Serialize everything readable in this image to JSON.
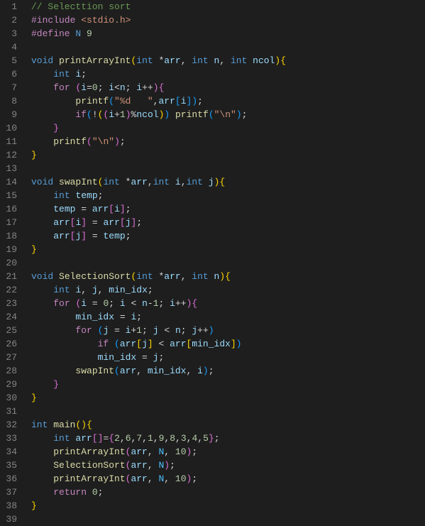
{
  "gutter": {
    "start": 1,
    "end": 39
  },
  "code": {
    "lines": [
      [
        [
          "tok-comment",
          "// Selecttion sort"
        ]
      ],
      [
        [
          "tok-keyword",
          "#include"
        ],
        [
          "tok-op",
          " "
        ],
        [
          "tok-string",
          "<stdio.h>"
        ]
      ],
      [
        [
          "tok-keyword",
          "#define"
        ],
        [
          "tok-op",
          " "
        ],
        [
          "tok-macrofn",
          "N"
        ],
        [
          "tok-op",
          " "
        ],
        [
          "tok-num",
          "9"
        ]
      ],
      [],
      [
        [
          "tok-type",
          "void"
        ],
        [
          "tok-op",
          " "
        ],
        [
          "tok-func",
          "printArrayInt"
        ],
        [
          "tok-brace",
          "("
        ],
        [
          "tok-type",
          "int"
        ],
        [
          "tok-op",
          " *"
        ],
        [
          "tok-var",
          "arr"
        ],
        [
          "tok-op",
          ", "
        ],
        [
          "tok-type",
          "int"
        ],
        [
          "tok-op",
          " "
        ],
        [
          "tok-var",
          "n"
        ],
        [
          "tok-op",
          ", "
        ],
        [
          "tok-type",
          "int"
        ],
        [
          "tok-op",
          " "
        ],
        [
          "tok-var",
          "ncol"
        ],
        [
          "tok-brace",
          ")"
        ],
        [
          "tok-brace",
          "{"
        ]
      ],
      [
        [
          "tok-op",
          "    "
        ],
        [
          "tok-type",
          "int"
        ],
        [
          "tok-op",
          " "
        ],
        [
          "tok-var",
          "i"
        ],
        [
          "tok-op",
          ";"
        ]
      ],
      [
        [
          "tok-op",
          "    "
        ],
        [
          "tok-keyword",
          "for"
        ],
        [
          "tok-op",
          " "
        ],
        [
          "tok-brace2",
          "("
        ],
        [
          "tok-var",
          "i"
        ],
        [
          "tok-op",
          "="
        ],
        [
          "tok-num",
          "0"
        ],
        [
          "tok-op",
          "; "
        ],
        [
          "tok-var",
          "i"
        ],
        [
          "tok-op",
          "<"
        ],
        [
          "tok-var",
          "n"
        ],
        [
          "tok-op",
          "; "
        ],
        [
          "tok-var",
          "i"
        ],
        [
          "tok-op",
          "++"
        ],
        [
          "tok-brace2",
          ")"
        ],
        [
          "tok-brace2",
          "{"
        ]
      ],
      [
        [
          "tok-op",
          "        "
        ],
        [
          "tok-func",
          "printf"
        ],
        [
          "tok-brace3",
          "("
        ],
        [
          "tok-string",
          "\"%d   \""
        ],
        [
          "tok-op",
          ","
        ],
        [
          "tok-var",
          "arr"
        ],
        [
          "tok-brace3",
          "["
        ],
        [
          "tok-var",
          "i"
        ],
        [
          "tok-brace3",
          "]"
        ],
        [
          "tok-brace3",
          ")"
        ],
        [
          "tok-op",
          ";"
        ]
      ],
      [
        [
          "tok-op",
          "        "
        ],
        [
          "tok-keyword",
          "if"
        ],
        [
          "tok-brace3",
          "("
        ],
        [
          "tok-op",
          "!"
        ],
        [
          "tok-brace",
          "("
        ],
        [
          "tok-brace2",
          "("
        ],
        [
          "tok-var",
          "i"
        ],
        [
          "tok-op",
          "+"
        ],
        [
          "tok-num",
          "1"
        ],
        [
          "tok-brace2",
          ")"
        ],
        [
          "tok-op",
          "%"
        ],
        [
          "tok-var",
          "ncol"
        ],
        [
          "tok-brace",
          ")"
        ],
        [
          "tok-brace3",
          ")"
        ],
        [
          "tok-op",
          " "
        ],
        [
          "tok-func",
          "printf"
        ],
        [
          "tok-brace3",
          "("
        ],
        [
          "tok-string",
          "\"\\n\""
        ],
        [
          "tok-brace3",
          ")"
        ],
        [
          "tok-op",
          ";"
        ]
      ],
      [
        [
          "tok-op",
          "    "
        ],
        [
          "tok-brace2",
          "}"
        ]
      ],
      [
        [
          "tok-op",
          "    "
        ],
        [
          "tok-func",
          "printf"
        ],
        [
          "tok-brace2",
          "("
        ],
        [
          "tok-string",
          "\"\\n\""
        ],
        [
          "tok-brace2",
          ")"
        ],
        [
          "tok-op",
          ";"
        ]
      ],
      [
        [
          "tok-brace",
          "}"
        ]
      ],
      [],
      [
        [
          "tok-type",
          "void"
        ],
        [
          "tok-op",
          " "
        ],
        [
          "tok-func",
          "swapInt"
        ],
        [
          "tok-brace",
          "("
        ],
        [
          "tok-type",
          "int"
        ],
        [
          "tok-op",
          " *"
        ],
        [
          "tok-var",
          "arr"
        ],
        [
          "tok-op",
          ","
        ],
        [
          "tok-type",
          "int"
        ],
        [
          "tok-op",
          " "
        ],
        [
          "tok-var",
          "i"
        ],
        [
          "tok-op",
          ","
        ],
        [
          "tok-type",
          "int"
        ],
        [
          "tok-op",
          " "
        ],
        [
          "tok-var",
          "j"
        ],
        [
          "tok-brace",
          ")"
        ],
        [
          "tok-brace",
          "{"
        ]
      ],
      [
        [
          "tok-op",
          "    "
        ],
        [
          "tok-type",
          "int"
        ],
        [
          "tok-op",
          " "
        ],
        [
          "tok-var",
          "temp"
        ],
        [
          "tok-op",
          ";"
        ]
      ],
      [
        [
          "tok-op",
          "    "
        ],
        [
          "tok-var",
          "temp"
        ],
        [
          "tok-op",
          " = "
        ],
        [
          "tok-var",
          "arr"
        ],
        [
          "tok-brace2",
          "["
        ],
        [
          "tok-var",
          "i"
        ],
        [
          "tok-brace2",
          "]"
        ],
        [
          "tok-op",
          ";"
        ]
      ],
      [
        [
          "tok-op",
          "    "
        ],
        [
          "tok-var",
          "arr"
        ],
        [
          "tok-brace2",
          "["
        ],
        [
          "tok-var",
          "i"
        ],
        [
          "tok-brace2",
          "]"
        ],
        [
          "tok-op",
          " = "
        ],
        [
          "tok-var",
          "arr"
        ],
        [
          "tok-brace2",
          "["
        ],
        [
          "tok-var",
          "j"
        ],
        [
          "tok-brace2",
          "]"
        ],
        [
          "tok-op",
          ";"
        ]
      ],
      [
        [
          "tok-op",
          "    "
        ],
        [
          "tok-var",
          "arr"
        ],
        [
          "tok-brace2",
          "["
        ],
        [
          "tok-var",
          "j"
        ],
        [
          "tok-brace2",
          "]"
        ],
        [
          "tok-op",
          " = "
        ],
        [
          "tok-var",
          "temp"
        ],
        [
          "tok-op",
          ";"
        ]
      ],
      [
        [
          "tok-brace",
          "}"
        ]
      ],
      [],
      [
        [
          "tok-type",
          "void"
        ],
        [
          "tok-op",
          " "
        ],
        [
          "tok-func",
          "SelectionSort"
        ],
        [
          "tok-brace",
          "("
        ],
        [
          "tok-type",
          "int"
        ],
        [
          "tok-op",
          " *"
        ],
        [
          "tok-var",
          "arr"
        ],
        [
          "tok-op",
          ", "
        ],
        [
          "tok-type",
          "int"
        ],
        [
          "tok-op",
          " "
        ],
        [
          "tok-var",
          "n"
        ],
        [
          "tok-brace",
          ")"
        ],
        [
          "tok-brace",
          "{"
        ]
      ],
      [
        [
          "tok-op",
          "    "
        ],
        [
          "tok-type",
          "int"
        ],
        [
          "tok-op",
          " "
        ],
        [
          "tok-var",
          "i"
        ],
        [
          "tok-op",
          ", "
        ],
        [
          "tok-var",
          "j"
        ],
        [
          "tok-op",
          ", "
        ],
        [
          "tok-var",
          "min_idx"
        ],
        [
          "tok-op",
          ";"
        ]
      ],
      [
        [
          "tok-op",
          "    "
        ],
        [
          "tok-keyword",
          "for"
        ],
        [
          "tok-op",
          " "
        ],
        [
          "tok-brace2",
          "("
        ],
        [
          "tok-var",
          "i"
        ],
        [
          "tok-op",
          " = "
        ],
        [
          "tok-num",
          "0"
        ],
        [
          "tok-op",
          "; "
        ],
        [
          "tok-var",
          "i"
        ],
        [
          "tok-op",
          " < "
        ],
        [
          "tok-var",
          "n"
        ],
        [
          "tok-op",
          "-"
        ],
        [
          "tok-num",
          "1"
        ],
        [
          "tok-op",
          "; "
        ],
        [
          "tok-var",
          "i"
        ],
        [
          "tok-op",
          "++"
        ],
        [
          "tok-brace2",
          ")"
        ],
        [
          "tok-brace2",
          "{"
        ]
      ],
      [
        [
          "tok-op",
          "        "
        ],
        [
          "tok-var",
          "min_idx"
        ],
        [
          "tok-op",
          " = "
        ],
        [
          "tok-var",
          "i"
        ],
        [
          "tok-op",
          ";"
        ]
      ],
      [
        [
          "tok-op",
          "        "
        ],
        [
          "tok-keyword",
          "for"
        ],
        [
          "tok-op",
          " "
        ],
        [
          "tok-brace3",
          "("
        ],
        [
          "tok-var",
          "j"
        ],
        [
          "tok-op",
          " = "
        ],
        [
          "tok-var",
          "i"
        ],
        [
          "tok-op",
          "+"
        ],
        [
          "tok-num",
          "1"
        ],
        [
          "tok-op",
          "; "
        ],
        [
          "tok-var",
          "j"
        ],
        [
          "tok-op",
          " < "
        ],
        [
          "tok-var",
          "n"
        ],
        [
          "tok-op",
          "; "
        ],
        [
          "tok-var",
          "j"
        ],
        [
          "tok-op",
          "++"
        ],
        [
          "tok-brace3",
          ")"
        ]
      ],
      [
        [
          "tok-op",
          "            "
        ],
        [
          "tok-keyword",
          "if"
        ],
        [
          "tok-op",
          " "
        ],
        [
          "tok-brace3",
          "("
        ],
        [
          "tok-var",
          "arr"
        ],
        [
          "tok-brace",
          "["
        ],
        [
          "tok-var",
          "j"
        ],
        [
          "tok-brace",
          "]"
        ],
        [
          "tok-op",
          " < "
        ],
        [
          "tok-var",
          "arr"
        ],
        [
          "tok-brace",
          "["
        ],
        [
          "tok-var",
          "min_idx"
        ],
        [
          "tok-brace",
          "]"
        ],
        [
          "tok-brace3",
          ")"
        ]
      ],
      [
        [
          "tok-op",
          "            "
        ],
        [
          "tok-var",
          "min_idx"
        ],
        [
          "tok-op",
          " = "
        ],
        [
          "tok-var",
          "j"
        ],
        [
          "tok-op",
          ";"
        ]
      ],
      [
        [
          "tok-op",
          "        "
        ],
        [
          "tok-func",
          "swapInt"
        ],
        [
          "tok-brace3",
          "("
        ],
        [
          "tok-var",
          "arr"
        ],
        [
          "tok-op",
          ", "
        ],
        [
          "tok-var",
          "min_idx"
        ],
        [
          "tok-op",
          ", "
        ],
        [
          "tok-var",
          "i"
        ],
        [
          "tok-brace3",
          ")"
        ],
        [
          "tok-op",
          ";"
        ]
      ],
      [
        [
          "tok-op",
          "    "
        ],
        [
          "tok-brace2",
          "}"
        ]
      ],
      [
        [
          "tok-brace",
          "}"
        ]
      ],
      [],
      [
        [
          "tok-type",
          "int"
        ],
        [
          "tok-op",
          " "
        ],
        [
          "tok-func",
          "main"
        ],
        [
          "tok-brace",
          "("
        ],
        [
          "tok-brace",
          ")"
        ],
        [
          "tok-brace",
          "{"
        ]
      ],
      [
        [
          "tok-op",
          "    "
        ],
        [
          "tok-type",
          "int"
        ],
        [
          "tok-op",
          " "
        ],
        [
          "tok-var",
          "arr"
        ],
        [
          "tok-brace2",
          "["
        ],
        [
          "tok-brace2",
          "]"
        ],
        [
          "tok-op",
          "="
        ],
        [
          "tok-brace2",
          "{"
        ],
        [
          "tok-num",
          "2"
        ],
        [
          "tok-op",
          ","
        ],
        [
          "tok-num",
          "6"
        ],
        [
          "tok-op",
          ","
        ],
        [
          "tok-num",
          "7"
        ],
        [
          "tok-op",
          ","
        ],
        [
          "tok-num",
          "1"
        ],
        [
          "tok-op",
          ","
        ],
        [
          "tok-num",
          "9"
        ],
        [
          "tok-op",
          ","
        ],
        [
          "tok-num",
          "8"
        ],
        [
          "tok-op",
          ","
        ],
        [
          "tok-num",
          "3"
        ],
        [
          "tok-op",
          ","
        ],
        [
          "tok-num",
          "4"
        ],
        [
          "tok-op",
          ","
        ],
        [
          "tok-num",
          "5"
        ],
        [
          "tok-brace2",
          "}"
        ],
        [
          "tok-op",
          ";"
        ]
      ],
      [
        [
          "tok-op",
          "    "
        ],
        [
          "tok-func",
          "printArrayInt"
        ],
        [
          "tok-brace2",
          "("
        ],
        [
          "tok-var",
          "arr"
        ],
        [
          "tok-op",
          ", "
        ],
        [
          "tok-const",
          "N"
        ],
        [
          "tok-op",
          ", "
        ],
        [
          "tok-num",
          "10"
        ],
        [
          "tok-brace2",
          ")"
        ],
        [
          "tok-op",
          ";"
        ]
      ],
      [
        [
          "tok-op",
          "    "
        ],
        [
          "tok-func",
          "SelectionSort"
        ],
        [
          "tok-brace2",
          "("
        ],
        [
          "tok-var",
          "arr"
        ],
        [
          "tok-op",
          ", "
        ],
        [
          "tok-const",
          "N"
        ],
        [
          "tok-brace2",
          ")"
        ],
        [
          "tok-op",
          ";"
        ]
      ],
      [
        [
          "tok-op",
          "    "
        ],
        [
          "tok-func",
          "printArrayInt"
        ],
        [
          "tok-brace2",
          "("
        ],
        [
          "tok-var",
          "arr"
        ],
        [
          "tok-op",
          ", "
        ],
        [
          "tok-const",
          "N"
        ],
        [
          "tok-op",
          ", "
        ],
        [
          "tok-num",
          "10"
        ],
        [
          "tok-brace2",
          ")"
        ],
        [
          "tok-op",
          ";"
        ]
      ],
      [
        [
          "tok-op",
          "    "
        ],
        [
          "tok-keyword",
          "return"
        ],
        [
          "tok-op",
          " "
        ],
        [
          "tok-num",
          "0"
        ],
        [
          "tok-op",
          ";"
        ]
      ],
      [
        [
          "tok-brace",
          "}"
        ]
      ],
      []
    ]
  }
}
